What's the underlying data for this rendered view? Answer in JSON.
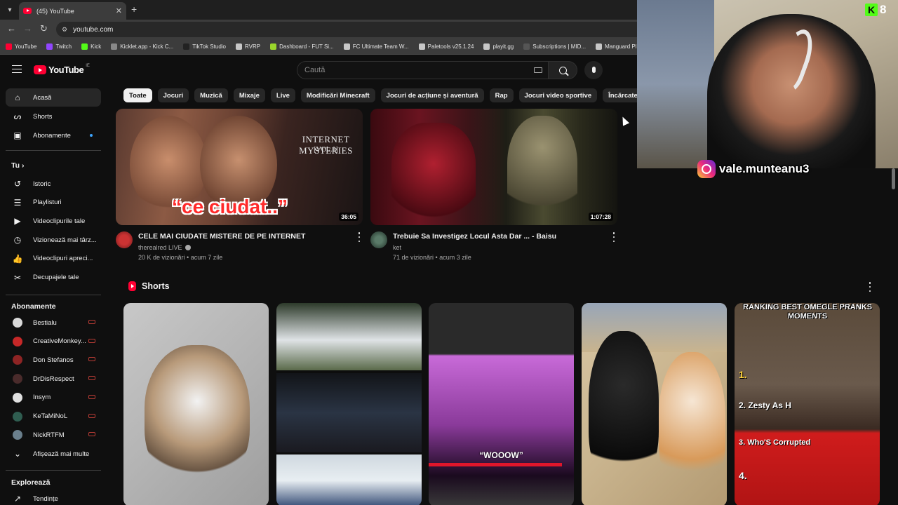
{
  "browser": {
    "tab_title": "(45) YouTube",
    "url": "youtube.com",
    "bookmarks": [
      {
        "label": "YouTube",
        "color": "#ff0033"
      },
      {
        "label": "Twitch",
        "color": "#9146ff"
      },
      {
        "label": "Kick",
        "color": "#53fc18"
      },
      {
        "label": "Kicklet.app - Kick C...",
        "color": "#888888"
      },
      {
        "label": "TikTok Studio",
        "color": "#222222"
      },
      {
        "label": "RVRP",
        "color": "#c7c7c7"
      },
      {
        "label": "Dashboard - FUT Si...",
        "color": "#9ad62b"
      },
      {
        "label": "FC Ultimate Team W...",
        "color": "#c7c7c7"
      },
      {
        "label": "Paletools v25.1.24",
        "color": "#c7c7c7"
      },
      {
        "label": "playit.gg",
        "color": "#c7c7c7"
      },
      {
        "label": "Subscriptions | MID...",
        "color": "#555555"
      },
      {
        "label": "Manguard Plus",
        "color": "#c7c7c7"
      }
    ]
  },
  "masthead": {
    "logo_text": "YouTube",
    "logo_country": "IE",
    "search_placeholder": "Caută"
  },
  "sidebar": {
    "main": [
      {
        "label": "Acasă",
        "icon": "home-icon"
      },
      {
        "label": "Shorts",
        "icon": "shorts-icon"
      },
      {
        "label": "Abonamente",
        "icon": "subscriptions-icon"
      }
    ],
    "you_heading": "Tu",
    "you_items": [
      {
        "label": "Istoric",
        "icon": "history-icon"
      },
      {
        "label": "Playlisturi",
        "icon": "playlist-icon"
      },
      {
        "label": "Videoclipurile tale",
        "icon": "your-videos-icon"
      },
      {
        "label": "Vizionează mai târz...",
        "icon": "watch-later-icon"
      },
      {
        "label": "Videoclipuri apreci...",
        "icon": "liked-icon"
      },
      {
        "label": "Decupajele tale",
        "icon": "clips-icon"
      }
    ],
    "subs_heading": "Abonamente",
    "subs": [
      {
        "label": "Bestialu",
        "color": "#d9d9d9"
      },
      {
        "label": "CreativeMonkey...",
        "color": "#c62828"
      },
      {
        "label": "Don Stefanos",
        "color": "#8e2424"
      },
      {
        "label": "DrDisRespect",
        "color": "#4a2b2b"
      },
      {
        "label": "Insym",
        "color": "#e0e0e0"
      },
      {
        "label": "KeTaMiNoL",
        "color": "#2f5d50"
      },
      {
        "label": "NickRTFM",
        "color": "#6a7f8c"
      }
    ],
    "show_more": "Afișează mai multe",
    "explore_heading": "Explorează",
    "explore_items": [
      {
        "label": "Tendințe",
        "icon": "trending-icon"
      }
    ]
  },
  "chips": [
    "Toate",
    "Jocuri",
    "Muzică",
    "Mixaje",
    "Live",
    "Modificări Minecraft",
    "Jocuri de acțiune și aventură",
    "Rap",
    "Jocuri video sportive",
    "Încărcate recent"
  ],
  "videos": [
    {
      "title": "CELE MAI CIUDATE MISTERE DE PE INTERNET",
      "channel": "therealred LIVE",
      "views": "20 K de vizionări",
      "age": "acum 7 zile",
      "duration": "36:05",
      "overlay_text": "“ce ciudat..”",
      "thumb_brand": "INTERNET MYSTERIES",
      "thumb_vol": "[VOL.1]"
    },
    {
      "title": "Trebuie Sa Investigez Locul Asta Dar ... - Baisu",
      "channel": "ket",
      "views": "71 de vizionări",
      "age": "acum 3 zile",
      "duration": "1:07:28"
    }
  ],
  "shorts": {
    "title": "Shorts",
    "items": [
      {
        "caption": ""
      },
      {
        "caption": ""
      },
      {
        "caption": "“WOOOW”"
      },
      {
        "caption": ""
      },
      {
        "caption": "RANKING BEST OMEGLE PRANKS MOMENTS",
        "rank1": "1.",
        "rank2": "2. Zesty As H",
        "rank3": "3. Who'S Corrupted",
        "rank4": "4."
      }
    ]
  },
  "overlay": {
    "instagram_handle": "vale.munteanu3",
    "kick_count": "8"
  },
  "colors": {
    "background": "#0f0f0f",
    "accent_red": "#ff0033",
    "kick_green": "#53fc18"
  }
}
